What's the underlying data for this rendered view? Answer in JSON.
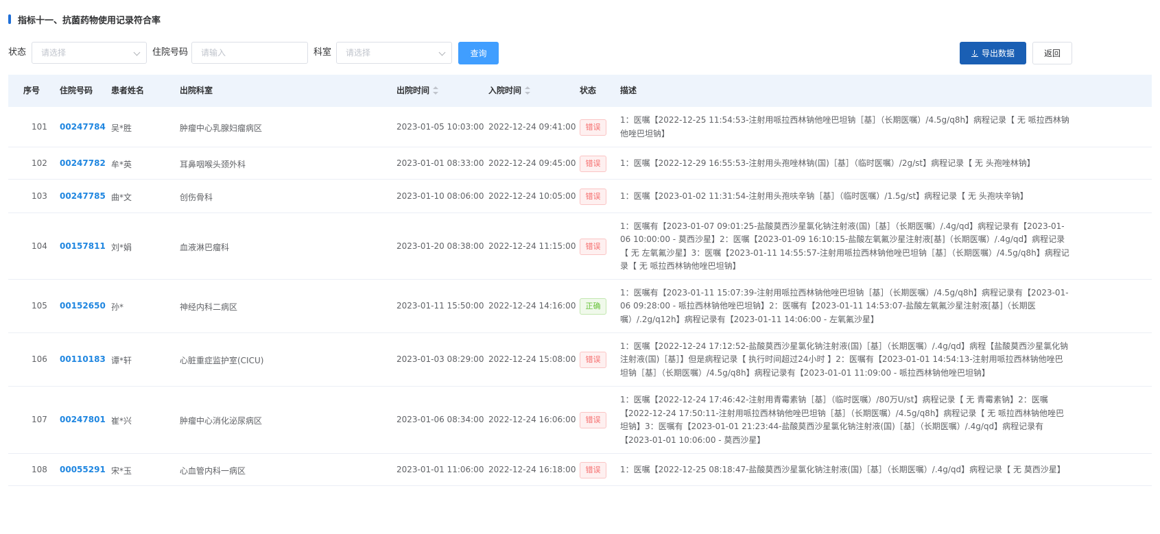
{
  "header": {
    "title": "指标十一、抗菌药物使用记录符合率"
  },
  "filters": {
    "status_label": "状态",
    "status_placeholder": "请选择",
    "admit_label": "住院号码",
    "admit_placeholder": "请输入",
    "dept_label": "科室",
    "dept_placeholder": "请选择",
    "query_label": "查询",
    "export_label": "导出数据",
    "back_label": "返回"
  },
  "table": {
    "headers": {
      "no": "序号",
      "admit": "住院号码",
      "name": "患者姓名",
      "dept": "出院科室",
      "out_time": "出院时间",
      "in_time": "入院时间",
      "status": "状态",
      "desc": "描述"
    },
    "rows": [
      {
        "no": "101",
        "admit": "00247784",
        "name": "吴*胜",
        "dept": "肿瘤中心乳腺妇瘤病区",
        "out_time": "2023-01-05 10:03:00",
        "in_time": "2022-12-24 09:41:00",
        "status": "错误",
        "status_type": "err",
        "desc": "1：医嘱【2022-12-25 11:54:53-注射用哌拉西林钠他唑巴坦钠［基］（长期医嘱）/4.5g/q8h】病程记录【 无 哌拉西林钠他唑巴坦钠】"
      },
      {
        "no": "102",
        "admit": "00247782",
        "name": "牟*英",
        "dept": "耳鼻咽喉头颈外科",
        "out_time": "2023-01-01 08:33:00",
        "in_time": "2022-12-24 09:45:00",
        "status": "错误",
        "status_type": "err",
        "desc": "1：医嘱【2022-12-29 16:55:53-注射用头孢唑林钠(国)［基］（临时医嘱）/2g/st】病程记录【 无 头孢唑林钠】"
      },
      {
        "no": "103",
        "admit": "00247785",
        "name": "曲*文",
        "dept": "创伤骨科",
        "out_time": "2023-01-10 08:06:00",
        "in_time": "2022-12-24 10:05:00",
        "status": "错误",
        "status_type": "err",
        "desc": "1：医嘱【2023-01-02 11:31:54-注射用头孢呋辛钠［基］（临时医嘱）/1.5g/st】病程记录【 无 头孢呋辛钠】"
      },
      {
        "no": "104",
        "admit": "00157811",
        "name": "刘*娟",
        "dept": "血液淋巴瘤科",
        "out_time": "2023-01-20 08:38:00",
        "in_time": "2022-12-24 11:15:00",
        "status": "错误",
        "status_type": "err",
        "desc": "1：医嘱有【2023-01-07 09:01:25-盐酸莫西沙星氯化钠注射液(国)［基］（长期医嘱）/.4g/qd】病程记录有【2023-01-06 10:00:00 - 莫西沙星】2：医嘱【2023-01-09 16:10:15-盐酸左氧氟沙星注射液[基]（长期医嘱）/.4g/qd】病程记录【 无 左氧氟沙星】3：医嘱【2023-01-11 14:55:57-注射用哌拉西林钠他唑巴坦钠［基］（长期医嘱）/4.5g/q8h】病程记录【 无 哌拉西林钠他唑巴坦钠】"
      },
      {
        "no": "105",
        "admit": "00152650",
        "name": "孙*",
        "dept": "神经内科二病区",
        "out_time": "2023-01-11 15:50:00",
        "in_time": "2022-12-24 14:16:00",
        "status": "正确",
        "status_type": "ok",
        "desc": "1：医嘱有【2023-01-11 15:07:39-注射用哌拉西林钠他唑巴坦钠［基］（长期医嘱）/4.5g/q8h】病程记录有【2023-01-06 09:28:00 - 哌拉西林钠他唑巴坦钠】2：医嘱有【2023-01-11 14:53:07-盐酸左氧氟沙星注射液[基]（长期医嘱）/.2g/q12h】病程记录有【2023-01-11 14:06:00 - 左氧氟沙星】"
      },
      {
        "no": "106",
        "admit": "00110183",
        "name": "谭*轩",
        "dept": "心脏重症监护室(CICU)",
        "out_time": "2023-01-03 08:29:00",
        "in_time": "2022-12-24 15:08:00",
        "status": "错误",
        "status_type": "err",
        "desc": "1：医嘱【2022-12-24 17:12:52-盐酸莫西沙星氯化钠注射液(国)［基］（长期医嘱）/.4g/qd】病程【盐酸莫西沙星氯化钠注射液(国)［基］】但是病程记录【 执行时间超过24小时 】2：医嘱有【2023-01-01 14:54:13-注射用哌拉西林钠他唑巴坦钠［基］（长期医嘱）/4.5g/q8h】病程记录有【2023-01-01 11:09:00 - 哌拉西林钠他唑巴坦钠】"
      },
      {
        "no": "107",
        "admit": "00247801",
        "name": "崔*兴",
        "dept": "肿瘤中心消化泌尿病区",
        "out_time": "2023-01-06 08:34:00",
        "in_time": "2022-12-24 16:06:00",
        "status": "错误",
        "status_type": "err",
        "desc": "1：医嘱【2022-12-24 17:46:42-注射用青霉素钠［基］（临时医嘱）/80万U/st】病程记录【 无 青霉素钠】2：医嘱【2022-12-24 17:50:11-注射用哌拉西林钠他唑巴坦钠［基］（长期医嘱）/4.5g/q8h】病程记录【 无 哌拉西林钠他唑巴坦钠】3：医嘱有【2023-01-01 21:23:44-盐酸莫西沙星氯化钠注射液(国)［基］（长期医嘱）/.4g/qd】病程记录有【2023-01-01 10:06:00 - 莫西沙星】"
      },
      {
        "no": "108",
        "admit": "00055291",
        "name": "宋*玉",
        "dept": "心血管内科一病区",
        "out_time": "2023-01-01 11:06:00",
        "in_time": "2022-12-24 16:18:00",
        "status": "错误",
        "status_type": "err",
        "desc": "1：医嘱【2022-12-25 08:18:47-盐酸莫西沙星氯化钠注射液(国)［基］（长期医嘱）/.4g/qd】病程记录【 无 莫西沙星】"
      }
    ]
  }
}
